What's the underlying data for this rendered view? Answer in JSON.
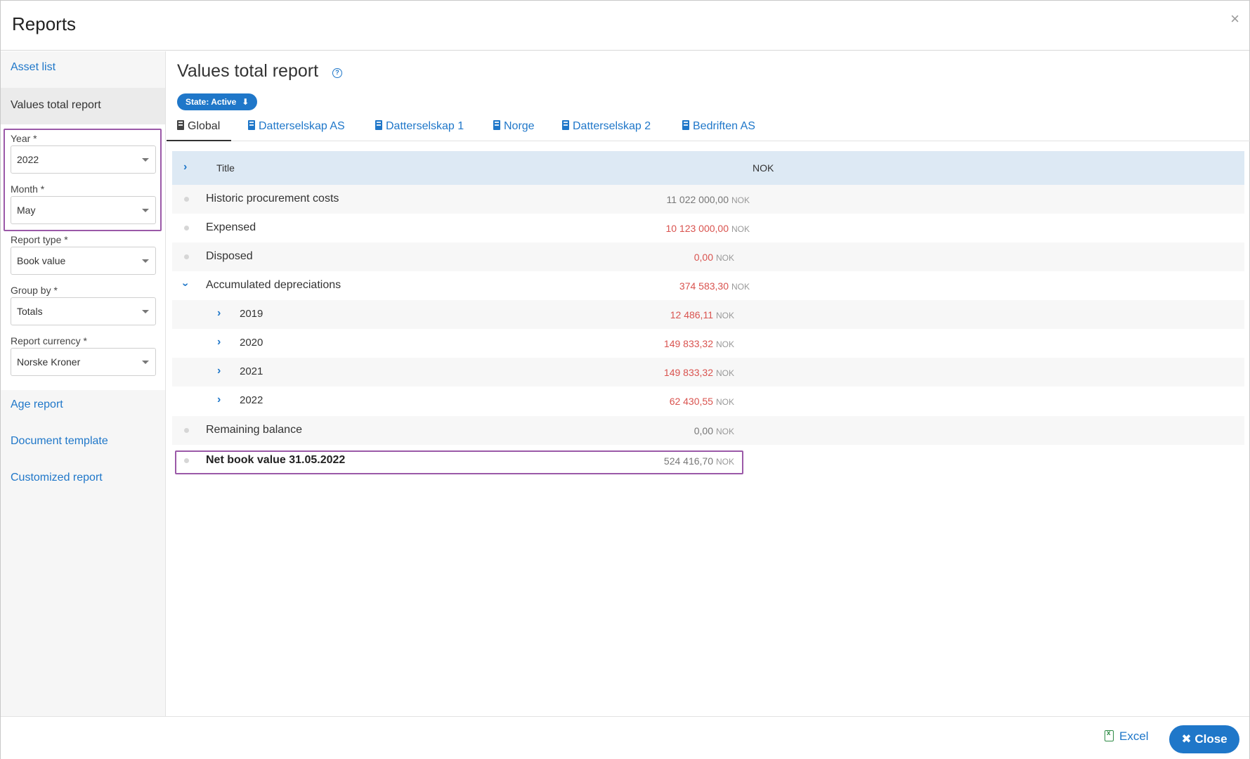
{
  "dialog": {
    "title": "Reports",
    "close_glyph": "×"
  },
  "sidebar": {
    "links_top": [
      "Asset list"
    ],
    "active_item": "Values total report",
    "links_bottom": [
      "Age report",
      "Document template",
      "Customized report"
    ],
    "filters": {
      "year": {
        "label": "Year *",
        "value": "2022"
      },
      "month": {
        "label": "Month *",
        "value": "May"
      },
      "report_type": {
        "label": "Report type *",
        "value": "Book value"
      },
      "group_by": {
        "label": "Group by *",
        "value": "Totals"
      },
      "report_currency": {
        "label": "Report currency *",
        "value": "Norske Kroner"
      }
    }
  },
  "main": {
    "title": "Values total report",
    "help_glyph": "?",
    "state_badge": {
      "label": "State: Active",
      "arrow": "⬇"
    },
    "tabs": [
      "Global",
      "Datterselskap AS",
      "Datterselskap 1",
      "Norge",
      "Datterselskap 2",
      "Bedriften AS"
    ],
    "table": {
      "columns": {
        "title": "Title",
        "nok": "NOK"
      },
      "currency": "NOK",
      "rows": [
        {
          "label": "Historic procurement costs",
          "amount": "11 022 000,00"
        },
        {
          "label": "Expensed",
          "amount": "10 123 000,00"
        },
        {
          "label": "Disposed",
          "amount": "0,00"
        },
        {
          "label": "Accumulated depreciations",
          "amount": "374 583,30"
        },
        {
          "label": "2019",
          "amount": "12 486,11"
        },
        {
          "label": "2020",
          "amount": "149 833,32"
        },
        {
          "label": "2021",
          "amount": "149 833,32"
        },
        {
          "label": "2022",
          "amount": "62 430,55"
        },
        {
          "label": "Remaining balance",
          "amount": "0,00"
        },
        {
          "label": "Net book value 31.05.2022",
          "amount": "524 416,70"
        }
      ]
    }
  },
  "footer": {
    "excel_label": "Excel",
    "close_label": "Close",
    "close_glyph": "✖"
  },
  "colors": {
    "accent": "#1f77c9",
    "negative": "#d9534f",
    "highlight": "#9b59a8",
    "header_row": "#dde9f4"
  }
}
